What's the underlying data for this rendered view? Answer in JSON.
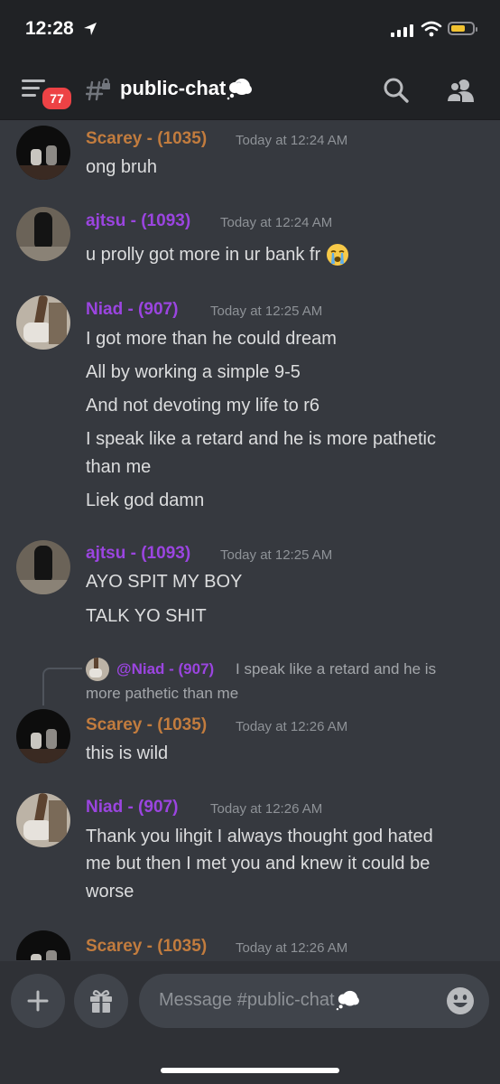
{
  "status_bar": {
    "time": "12:28"
  },
  "header": {
    "badge_count": "77",
    "channel_name": "public-chat"
  },
  "messages": [
    {
      "author": "Scarey - (1035)",
      "timestamp": "Today at 12:24 AM",
      "lines": [
        "ong bruh"
      ]
    },
    {
      "author": "ajtsu - (1093)",
      "timestamp": "Today at 12:24 AM",
      "lines": [
        "u prolly got more in ur bank fr"
      ]
    },
    {
      "author": "Niad - (907)",
      "timestamp": "Today at 12:25 AM",
      "lines": [
        "I got more than he could dream",
        "All by working a simple 9-5",
        "And not devoting my life to r6",
        "I speak like a retard and he is more pathetic",
        "than me",
        "Liek god damn"
      ]
    },
    {
      "author": "ajtsu - (1093)",
      "timestamp": "Today at 12:25 AM",
      "lines": [
        "AYO SPIT MY BOY",
        "TALK YO SHIT"
      ]
    },
    {
      "author": "Scarey - (1035)",
      "timestamp": "Today at 12:26 AM",
      "lines": [
        "this is wild"
      ],
      "reply": {
        "author": "@Niad - (907)",
        "text_line1": "I speak like a retard and he is",
        "text_line2": "more pathetic than me"
      }
    },
    {
      "author": "Niad - (907)",
      "timestamp": "Today at 12:26 AM",
      "lines": [
        "Thank you lihgit I always thought god hated",
        "me but then I met you and knew it could be",
        "worse"
      ]
    },
    {
      "author": "Scarey - (1035)",
      "timestamp": "Today at 12:26 AM",
      "lines": []
    }
  ],
  "composer": {
    "placeholder": "Message #public-chat"
  },
  "colors": {
    "background": "#36393f",
    "header": "#202225",
    "role_orange": "#c27c3e",
    "role_purple": "#9b45e0",
    "badge_red": "#ed4245",
    "timestamp": "#8e9297"
  },
  "icons": [
    "location-arrow-icon",
    "cellular-signal-icon",
    "wifi-icon",
    "battery-icon",
    "hamburger-menu-icon",
    "locked-channel-icon",
    "thought-balloon-emoji",
    "search-icon",
    "members-icon",
    "sob-emoji",
    "plus-icon",
    "gift-icon",
    "emoji-picker-icon"
  ]
}
